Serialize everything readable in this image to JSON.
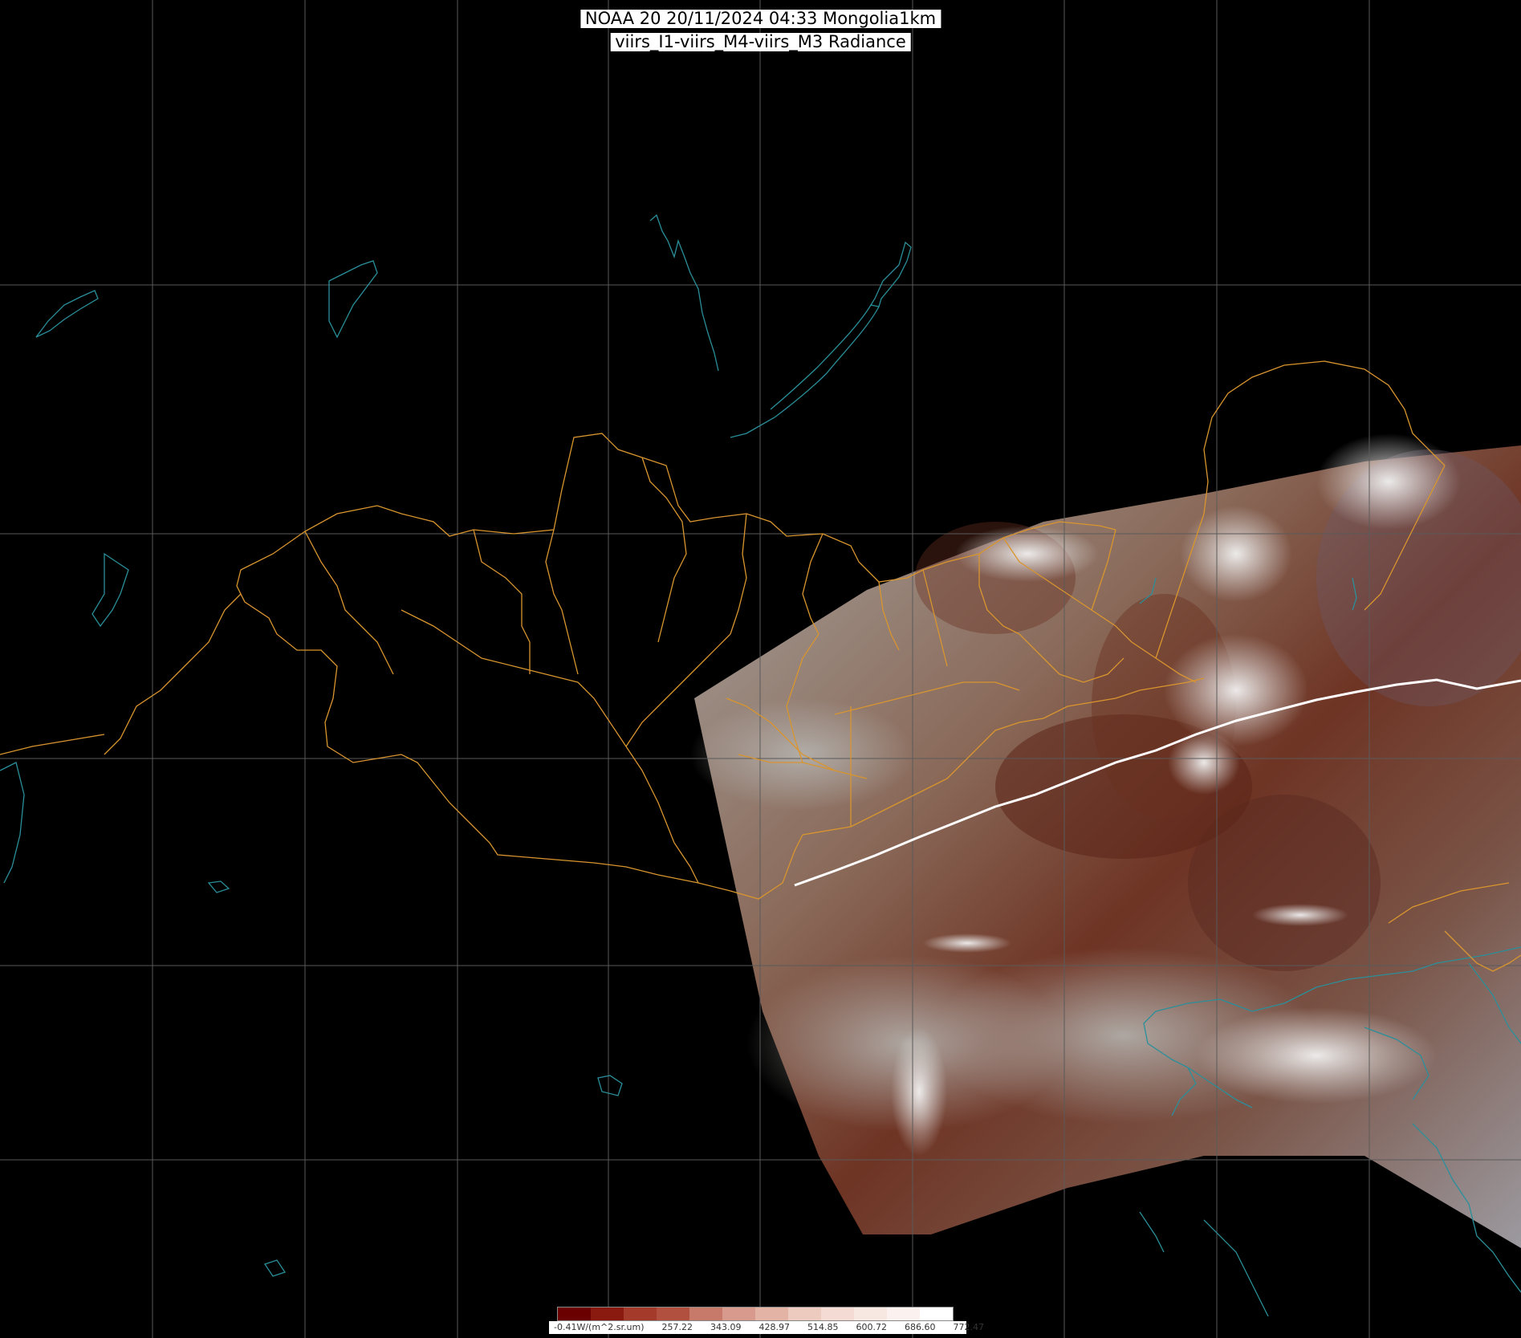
{
  "title": {
    "line1": "NOAA 20 20/11/2024 04:33 Mongolia1km",
    "line2": "viirs_I1-viirs_M4-viirs_M3 Radiance"
  },
  "legend": {
    "labels": [
      "-0.41W/(m^2.sr.um)",
      "257.22",
      "343.09",
      "428.97",
      "514.85",
      "600.72",
      "686.60",
      "772.47"
    ],
    "colors": [
      "#6a0000",
      "#8a1a10",
      "#a33a2a",
      "#b25040",
      "#c87a6a",
      "#d79a8c",
      "#e3b3a6",
      "#eecbbf",
      "#f4dcd4",
      "#f8e8e2",
      "#fbf1ee",
      "#ffffff"
    ]
  },
  "map_colors": {
    "background": "#000000",
    "graticule": "#5a5a5a",
    "admin_borders": "#d9952e",
    "coastline": "#2a8f9a",
    "swath_bright": "#b9b6b2",
    "swath_brown": "#6b2f1e",
    "orbit_track": "#ffffff"
  }
}
